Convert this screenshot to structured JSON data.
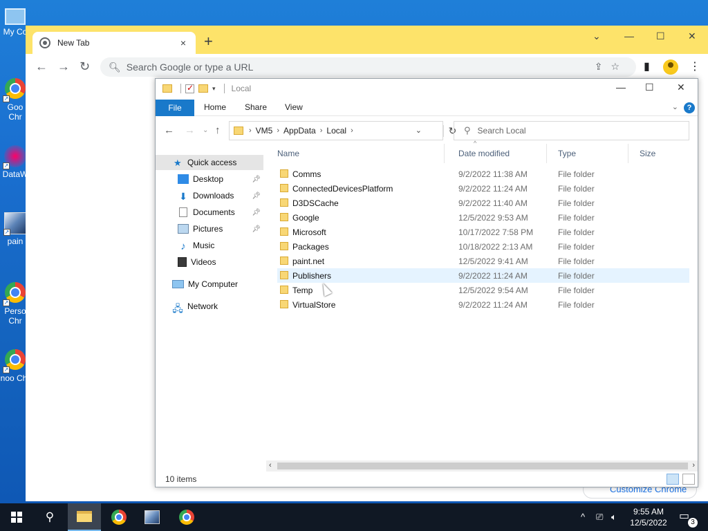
{
  "desktop": {
    "icons": [
      {
        "label": "My Co",
        "icon": "computer-icon"
      },
      {
        "label": "Goo Chr",
        "icon": "chrome-icon"
      },
      {
        "label": "DataW",
        "icon": "app-icon"
      },
      {
        "label": "pain",
        "icon": "paint-icon"
      },
      {
        "label": "Perso Chr",
        "icon": "chrome-icon"
      },
      {
        "label": "noo Chr",
        "icon": "chrome-icon"
      }
    ]
  },
  "chrome": {
    "tab_title": "New Tab",
    "tab_close": "×",
    "new_tab": "+",
    "omnibox_placeholder": "Search Google or type a URL",
    "customize_label": "Customize Chrome",
    "minimize": "—",
    "maximize": "☐",
    "close": "✕",
    "tab_strip_color": "#fde36a"
  },
  "explorer": {
    "title": "Local",
    "ribbon": {
      "file": "File",
      "tabs": [
        "Home",
        "Share",
        "View"
      ],
      "help": "?"
    },
    "breadcrumb": [
      "VM5",
      "AppData",
      "Local"
    ],
    "search_placeholder": "Search Local",
    "nav": {
      "quick_access": "Quick access",
      "items": [
        {
          "label": "Desktop",
          "pinned": true
        },
        {
          "label": "Downloads",
          "pinned": true
        },
        {
          "label": "Documents",
          "pinned": true
        },
        {
          "label": "Pictures",
          "pinned": true
        },
        {
          "label": "Music",
          "pinned": false
        },
        {
          "label": "Videos",
          "pinned": false
        }
      ],
      "my_computer": "My Computer",
      "network": "Network"
    },
    "columns": {
      "name": "Name",
      "date": "Date modified",
      "type": "Type",
      "size": "Size"
    },
    "rows": [
      {
        "name": "Comms",
        "date": "9/2/2022 11:38 AM",
        "type": "File folder"
      },
      {
        "name": "ConnectedDevicesPlatform",
        "date": "9/2/2022 11:24 AM",
        "type": "File folder"
      },
      {
        "name": "D3DSCache",
        "date": "9/2/2022 11:40 AM",
        "type": "File folder"
      },
      {
        "name": "Google",
        "date": "12/5/2022 9:53 AM",
        "type": "File folder"
      },
      {
        "name": "Microsoft",
        "date": "10/17/2022 7:58 PM",
        "type": "File folder"
      },
      {
        "name": "Packages",
        "date": "10/18/2022 2:13 AM",
        "type": "File folder"
      },
      {
        "name": "paint.net",
        "date": "12/5/2022 9:41 AM",
        "type": "File folder"
      },
      {
        "name": "Publishers",
        "date": "9/2/2022 11:24 AM",
        "type": "File folder"
      },
      {
        "name": "Temp",
        "date": "12/5/2022 9:54 AM",
        "type": "File folder"
      },
      {
        "name": "VirtualStore",
        "date": "9/2/2022 11:24 AM",
        "type": "File folder"
      }
    ],
    "status": "10 items",
    "accent_color": "#1979ca"
  },
  "taskbar": {
    "time": "9:55 AM",
    "date": "12/5/2022",
    "notifications": "3",
    "tray_icons": [
      "chevron-up-icon",
      "network-icon",
      "volume-icon"
    ]
  }
}
